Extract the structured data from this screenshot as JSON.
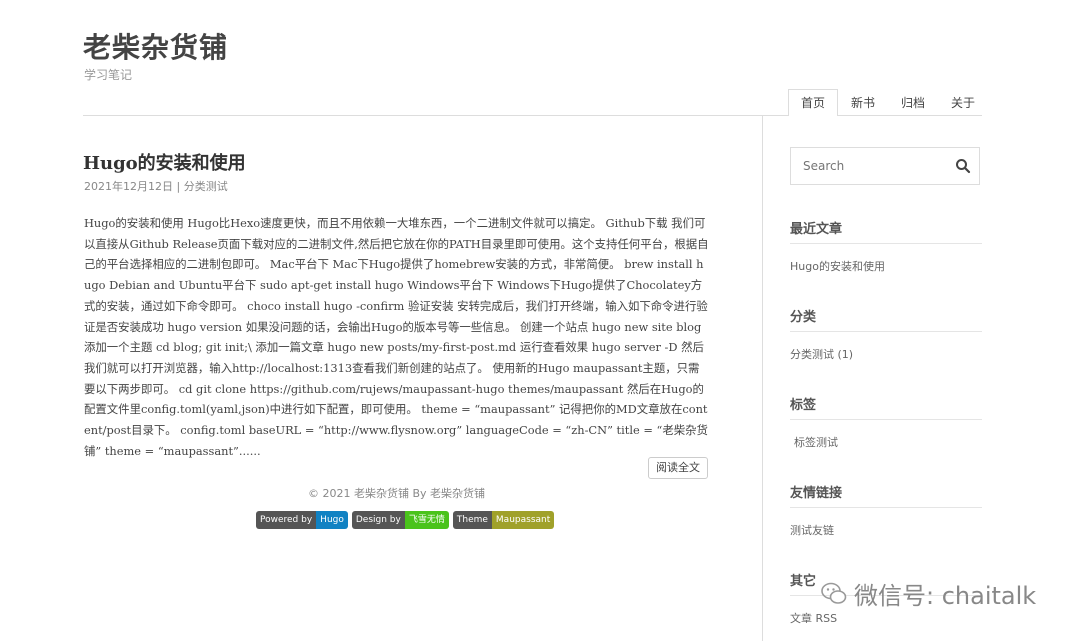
{
  "site": {
    "title": "老柴杂货铺",
    "subtitle": "学习笔记"
  },
  "nav": {
    "items": [
      "首页",
      "新书",
      "归档",
      "关于"
    ]
  },
  "post": {
    "title": "Hugo的安装和使用",
    "date": "2021年12月12日",
    "separator": "|",
    "category": "分类测试",
    "body": "Hugo的安装和使用 Hugo比Hexo速度更快，而且不用依赖一大堆东西，一个二进制文件就可以搞定。 Github下载 我们可以直接从Github Release页面下载对应的二进制文件,然后把它放在你的PATH目录里即可使用。这个支持任何平台，根据自己的平台选择相应的二进制包即可。 Mac平台下 Mac下Hugo提供了homebrew安装的方式，非常简便。 brew install hugo Debian and Ubuntu平台下 sudo apt-get install hugo Windows平台下 Windows下Hugo提供了Chocolatey方式的安装，通过如下命令即可。 choco install hugo -confirm 验证安装 安转完成后，我们打开终端，输入如下命令进行验证是否安装成功 hugo version 如果没问题的话，会输出Hugo的版本号等一些信息。 创建一个站点 hugo new site blog 添加一个主题 cd blog; git init;\\ 添加一篇文章 hugo new posts/my-first-post.md 运行查看效果 hugo server -D 然后我们就可以打开浏览器，输入http://localhost:1313查看我们新创建的站点了。 使用新的Hugo maupassant主题，只需要以下两步即可。 cd git clone https://github.com/rujews/maupassant-hugo themes/maupassant 然后在Hugo的配置文件里config.toml(yaml,json)中进行如下配置，即可使用。 theme = “maupassant” 记得把你的MD文章放在content/post目录下。 config.toml baseURL = “http://www.flysnow.org” languageCode = “zh-CN” title = “老柴杂货铺” theme = “maupassant”......",
    "read_more": "阅读全文"
  },
  "footer": {
    "copyright": "© 2021 老柴杂货铺 By 老柴杂货铺",
    "badges": [
      {
        "left": "Powered by",
        "right": "Hugo",
        "color": "#1182c3"
      },
      {
        "left": "Design by",
        "right": "飞雪无情",
        "color": "#4ac31b"
      },
      {
        "left": "Theme",
        "right": "Maupassant",
        "color": "#a0a12a"
      }
    ]
  },
  "sidebar": {
    "search_placeholder": "Search",
    "recent": {
      "title": "最近文章",
      "items": [
        "Hugo的安装和使用"
      ]
    },
    "categories": {
      "title": "分类",
      "items": [
        "分类测试 (1)"
      ]
    },
    "tags": {
      "title": "标签",
      "items": [
        "标签测试"
      ]
    },
    "links": {
      "title": "友情链接",
      "items": [
        "测试友链"
      ]
    },
    "other": {
      "title": "其它",
      "items": [
        "文章 RSS"
      ]
    }
  },
  "watermark": {
    "text": "微信号: chaitalk"
  },
  "colors": {
    "text": "#444444",
    "muted": "#888888",
    "border": "#dddddd"
  }
}
